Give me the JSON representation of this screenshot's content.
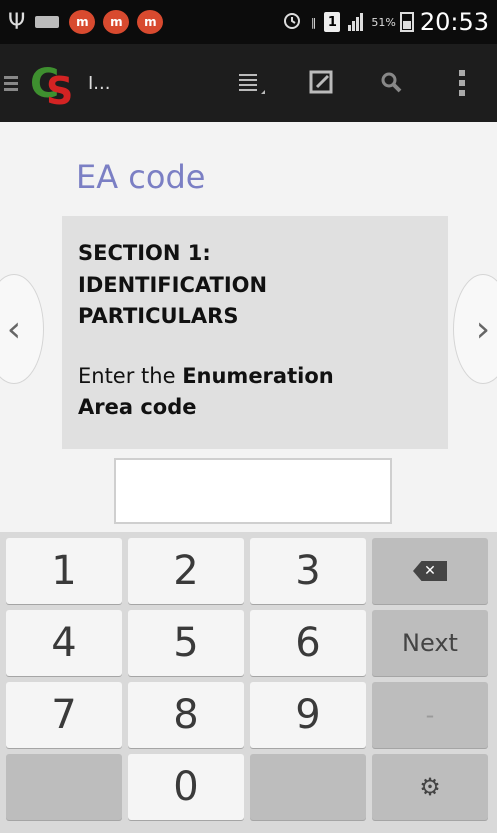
{
  "status_bar": {
    "usb_icon": "usb-icon",
    "notifications": [
      "m",
      "m",
      "m"
    ],
    "alarm_icon": "alarm-icon",
    "sim_label": "1",
    "battery_percent": "51%",
    "time": "20:53"
  },
  "action_bar": {
    "title": "I...",
    "actions": [
      "list-icon",
      "edit-icon",
      "search-icon",
      "overflow-icon"
    ]
  },
  "question": {
    "title": "EA code",
    "section_line1": "SECTION 1:",
    "section_line2": "IDENTIFICATION",
    "section_line3": "PARTICULARS",
    "prompt_prefix": "Enter the ",
    "prompt_bold_line1": "Enumeration",
    "prompt_bold_line2": "Area code",
    "answer_value": ""
  },
  "keyboard": {
    "rows": [
      [
        "1",
        "2",
        "3",
        "⌫"
      ],
      [
        "4",
        "5",
        "6",
        "Next"
      ],
      [
        "7",
        "8",
        "9",
        "-"
      ],
      [
        "",
        "0",
        "",
        "⚙"
      ]
    ]
  },
  "colors": {
    "title": "#7b7fc4",
    "action_bar": "#1d1d1d",
    "status_bar": "#0c0c0c",
    "card": "#e0e0e0"
  }
}
